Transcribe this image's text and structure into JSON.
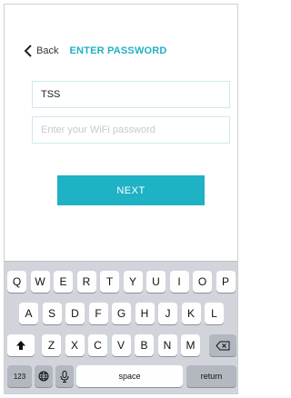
{
  "header": {
    "back_label": "Back",
    "title": "ENTER PASSWORD"
  },
  "form": {
    "ssid_value": "TSS",
    "password_placeholder": "Enter your WiFi password",
    "next_label": "NEXT"
  },
  "keyboard": {
    "row1": [
      "Q",
      "W",
      "E",
      "R",
      "T",
      "Y",
      "U",
      "I",
      "O",
      "P"
    ],
    "row2": [
      "A",
      "S",
      "D",
      "F",
      "G",
      "H",
      "J",
      "K",
      "L"
    ],
    "row3": [
      "Z",
      "X",
      "C",
      "V",
      "B",
      "N",
      "M"
    ],
    "numbers_label": "123",
    "space_label": "space",
    "return_label": "return",
    "icons": {
      "shift": "shift-icon",
      "backspace": "backspace-icon",
      "globe": "globe-icon",
      "mic": "microphone-icon"
    }
  },
  "colors": {
    "accent": "#1fb1c4",
    "keyboard_bg": "#d1d5db",
    "key_bg": "#fefefe",
    "function_key_bg": "#b3b8c0"
  }
}
